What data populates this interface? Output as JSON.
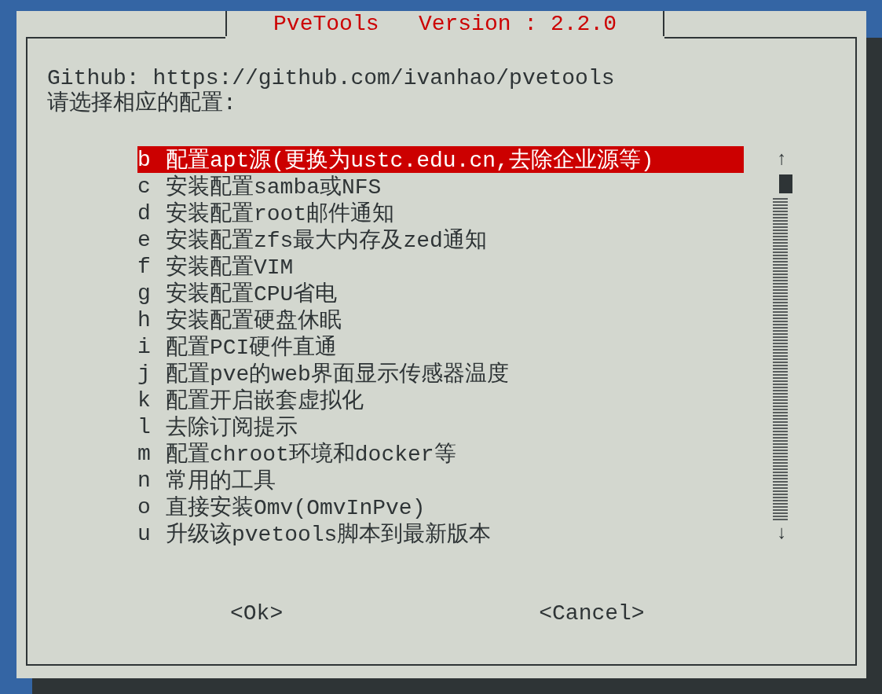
{
  "dialog": {
    "title": "PveTools   Version : 2.2.0",
    "message": [
      "Github: https://github.com/ivanhao/pvetools",
      "请选择相应的配置:"
    ]
  },
  "menu": [
    {
      "tag": "b",
      "label": "配置apt源(更换为ustc.edu.cn,去除企业源等)",
      "selected": true
    },
    {
      "tag": "c",
      "label": "安装配置samba或NFS",
      "selected": false
    },
    {
      "tag": "d",
      "label": "安装配置root邮件通知",
      "selected": false
    },
    {
      "tag": "e",
      "label": "安装配置zfs最大内存及zed通知",
      "selected": false
    },
    {
      "tag": "f",
      "label": "安装配置VIM",
      "selected": false
    },
    {
      "tag": "g",
      "label": "安装配置CPU省电",
      "selected": false
    },
    {
      "tag": "h",
      "label": "安装配置硬盘休眠",
      "selected": false
    },
    {
      "tag": "i",
      "label": "配置PCI硬件直通",
      "selected": false
    },
    {
      "tag": "j",
      "label": "配置pve的web界面显示传感器温度",
      "selected": false
    },
    {
      "tag": "k",
      "label": "配置开启嵌套虚拟化",
      "selected": false
    },
    {
      "tag": "l",
      "label": "去除订阅提示",
      "selected": false
    },
    {
      "tag": "m",
      "label": "配置chroot环境和docker等",
      "selected": false
    },
    {
      "tag": "n",
      "label": "常用的工具",
      "selected": false
    },
    {
      "tag": "o",
      "label": "直接安装Omv(OmvInPve)",
      "selected": false
    },
    {
      "tag": "u",
      "label": "升级该pvetools脚本到最新版本",
      "selected": false
    }
  ],
  "scroll_arrows": [
    "↑",
    "↓"
  ],
  "buttons": [
    "<Ok>",
    "<Cancel>"
  ]
}
